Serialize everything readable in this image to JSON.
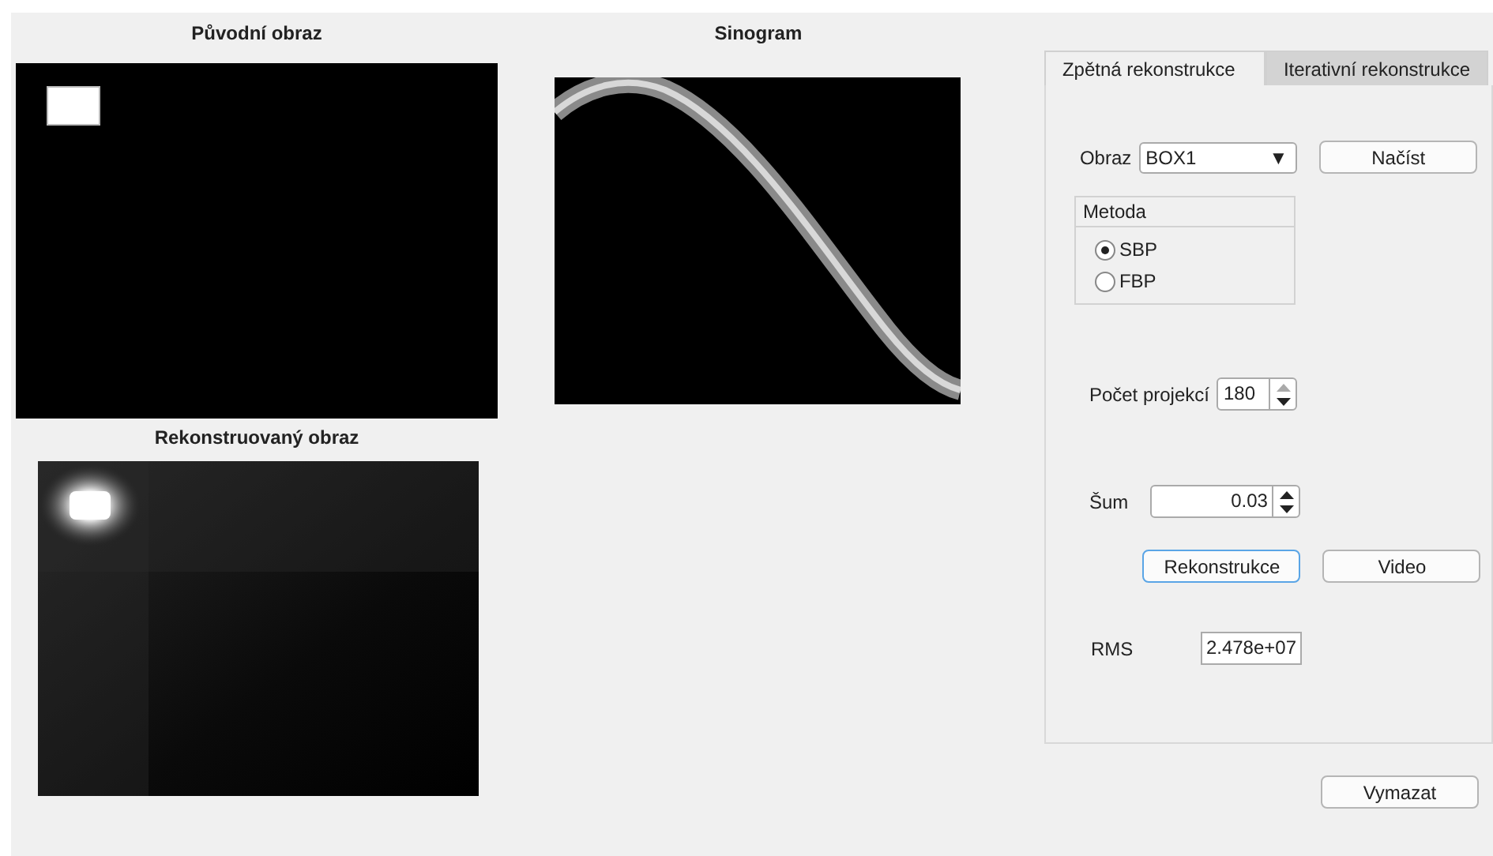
{
  "plots": {
    "original": {
      "title": "Původní obraz"
    },
    "sinogram": {
      "title": "Sinogram"
    },
    "reconstructed": {
      "title": "Rekonstruovaný obraz"
    }
  },
  "tabs": [
    {
      "label": "Zpětná rekonstrukce",
      "selected": true
    },
    {
      "label": "Iterativní rekonstrukce",
      "selected": false
    }
  ],
  "image_select": {
    "label": "Obraz",
    "value": "BOX1",
    "arrow": "▼"
  },
  "load_button": {
    "label": "Načíst"
  },
  "method": {
    "title": "Metoda",
    "options": [
      {
        "label": "SBP",
        "selected": true
      },
      {
        "label": "FBP",
        "selected": false
      }
    ]
  },
  "projections": {
    "label": "Počet projekcí",
    "value": "180",
    "up_enabled": false,
    "down_enabled": true
  },
  "noise": {
    "label": "Šum",
    "value": "0.03",
    "up_enabled": true,
    "down_enabled": true
  },
  "action_buttons": [
    {
      "label": "Rekonstrukce",
      "focused": true
    },
    {
      "label": "Video",
      "focused": false
    }
  ],
  "rms": {
    "label": "RMS",
    "value": "2.478e+07"
  },
  "clear_button": {
    "label": "Vymazat"
  }
}
